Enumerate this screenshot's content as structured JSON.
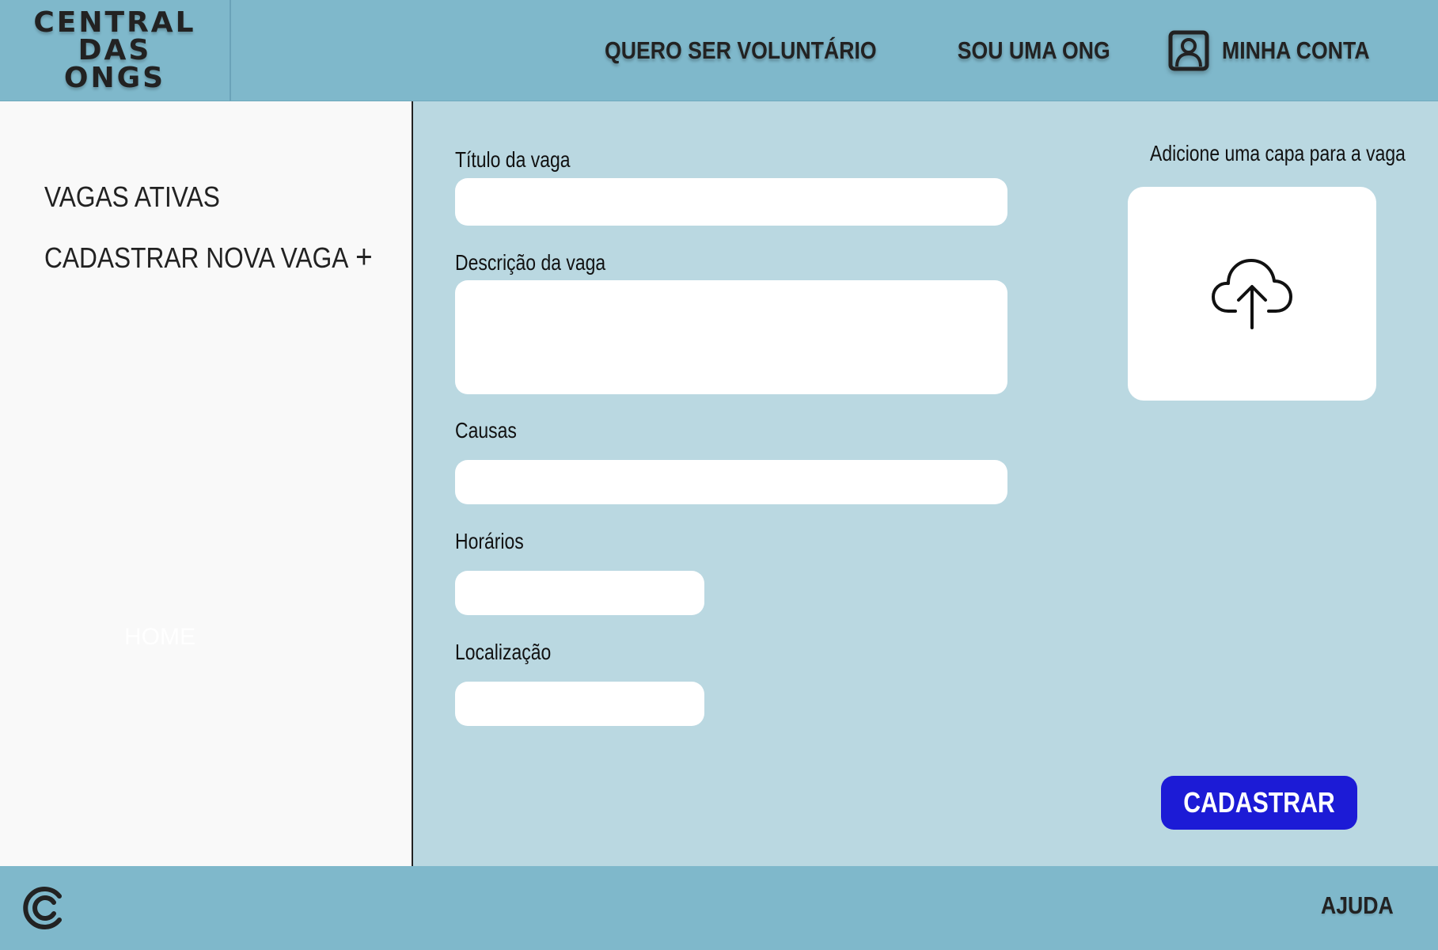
{
  "brand": {
    "line1": "CENTRAL",
    "line2": "DAS",
    "line3": "ONGS"
  },
  "nav": {
    "volunteer": "QUERO SER VOLUNTÁRIO",
    "ngo": "SOU UMA ONG",
    "account": "MINHA CONTA",
    "account_icon": "user-account-icon"
  },
  "sidebar": {
    "items": [
      {
        "label": "VAGAS ATIVAS"
      },
      {
        "label": "CADASTRAR NOVA VAGA",
        "icon": "+"
      }
    ],
    "home": "HOME"
  },
  "form": {
    "title_label": "Título da vaga",
    "title_value": "",
    "description_label": "Descrição da vaga",
    "description_value": "",
    "causes_label": "Causas",
    "causes_value": "",
    "schedule_label": "Horários",
    "schedule_value": "",
    "location_label": "Localização",
    "location_value": "",
    "cover_label": "Adicione uma capa para a vaga",
    "upload_icon": "cloud-upload-icon",
    "submit": "CADASTRAR"
  },
  "footer": {
    "logo_icon": "c-logo-icon",
    "help": "AJUDA"
  },
  "colors": {
    "header_bg": "#7fb8cb",
    "main_bg": "#bad8e1",
    "sidebar_bg": "#f9f9f9",
    "button_bg": "#1c1bd6"
  }
}
